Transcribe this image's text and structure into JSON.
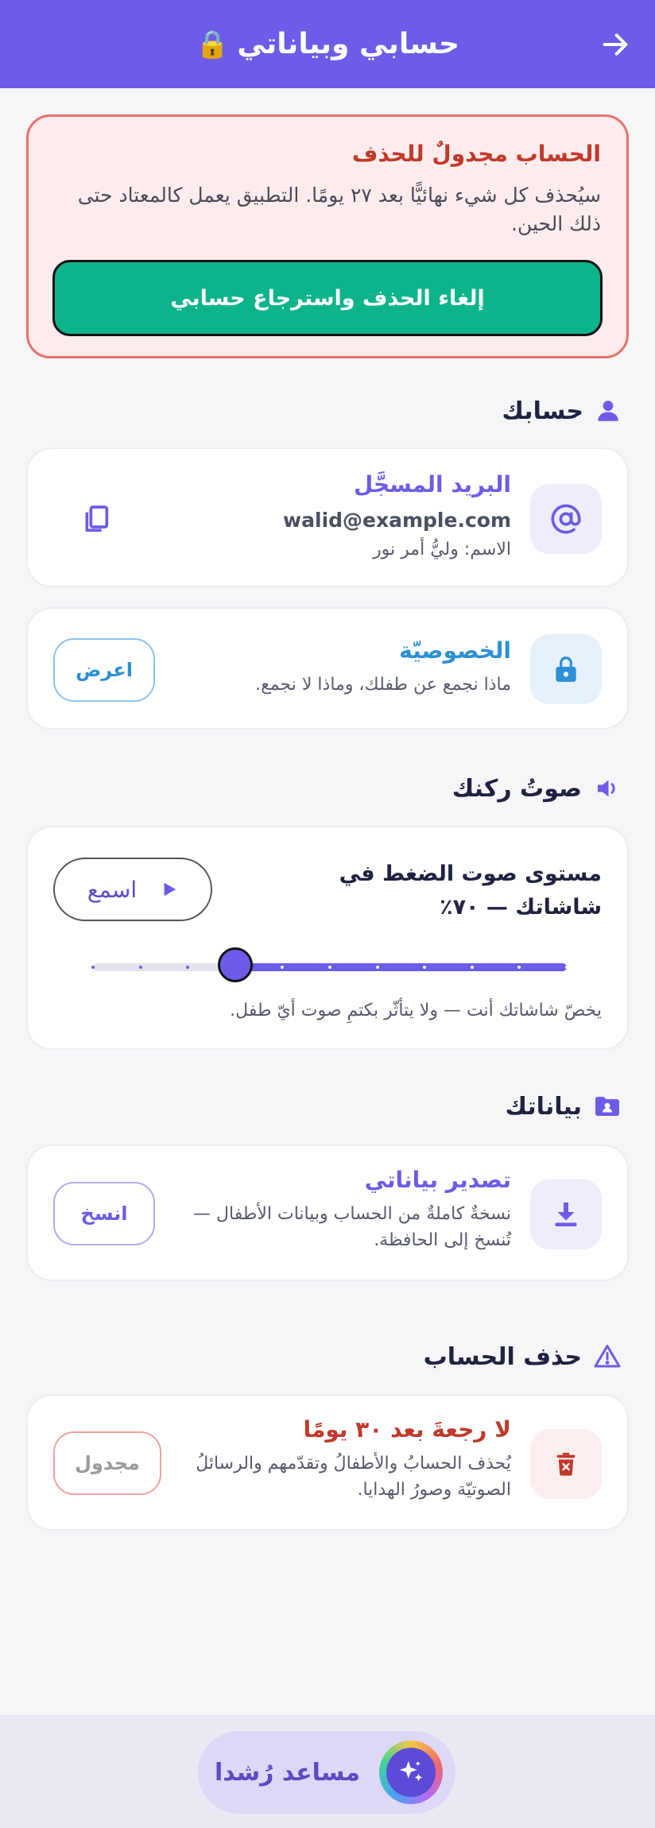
{
  "header": {
    "title": "حسابي وبياناتي",
    "title_icon": "lock-emoji",
    "back_icon": "arrow-right-icon"
  },
  "deletion_warning": {
    "title": "الحساب مجدولٌ للحذف",
    "text": "سيُحذف كل شيء نهائيًّا بعد ٢٧ يومًا. التطبيق يعمل كالمعتاد حتى ذلك الحين.",
    "restore_button": "إلغاء الحذف واسترجاع حسابي"
  },
  "account_section": {
    "title": "حسابك",
    "icon": "user-icon",
    "email_card": {
      "title": "البريد المسجَّل",
      "email": "walid@example.com",
      "name_line": "الاسم: وليُّ أمر نور",
      "icon": "at-sign-icon",
      "action_icon": "copy-icon"
    },
    "privacy_card": {
      "title": "الخصوصيّة",
      "subtitle": "ماذا نجمع عن طفلك، وماذا لا نجمع.",
      "icon": "lock-icon",
      "button": "اعرض"
    }
  },
  "voice_section": {
    "title": "صوتُ ركنك",
    "icon": "speaker-icon",
    "card": {
      "title": "مستوى صوت الضغط في شاشاتك — ٧٠٪",
      "listen_button": "اسمع",
      "slider_value_percent": 70,
      "note": "يخصّ شاشاتك أنت — ولا يتأثّر بكتمِ صوت أيّ طفل."
    }
  },
  "data_section": {
    "title": "بياناتك",
    "icon": "folder-user-icon",
    "export_card": {
      "title": "تصدير بياناتي",
      "subtitle": "نسخةٌ كاملةٌ من الحساب وبيانات الأطفال — تُنسخ إلى الحافظة.",
      "icon": "download-icon",
      "button": "انسخ"
    }
  },
  "delete_section": {
    "title": "حذف الحساب",
    "icon": "warning-triangle-icon",
    "card": {
      "title": "لا رجعةَ بعد ٣٠ يومًا",
      "subtitle": "يُحذف الحسابُ والأطفالُ وتقدّمهم والرسائلُ الصوتيّة وصورُ الهدايا.",
      "icon": "trash-x-icon",
      "button": "مجدول"
    }
  },
  "assistant": {
    "label": "مساعد رُشدا",
    "icon": "sparkles-icon"
  },
  "colors": {
    "brand": "#6c5ce7",
    "danger": "#c0392b",
    "success": "#0cb48b",
    "info": "#2d8fd5"
  }
}
